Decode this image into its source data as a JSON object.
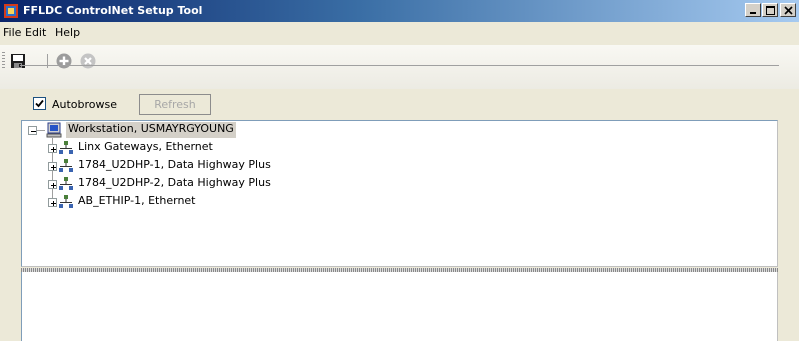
{
  "window": {
    "title": "FFLDC ControlNet Setup Tool",
    "icon": "app-icon",
    "buttons": [
      "minimize",
      "maximize",
      "close"
    ]
  },
  "menu": {
    "items": [
      "File",
      "Edit",
      "Help"
    ]
  },
  "toolbar": {
    "buttons": [
      "save-icon",
      "add-icon",
      "remove-icon"
    ]
  },
  "autobrowse": {
    "label": "Autobrowse",
    "checked": true
  },
  "refresh": {
    "label": "Refresh",
    "enabled": false
  },
  "tree": {
    "root": {
      "label": "Workstation, USMAYRGYOUNG",
      "expanded": true,
      "icon": "computer-icon",
      "selected": true
    },
    "children": [
      {
        "label": "Linx Gateways, Ethernet",
        "icon": "network-icon"
      },
      {
        "label": "1784_U2DHP-1, Data Highway Plus",
        "icon": "network-icon"
      },
      {
        "label": "1784_U2DHP-2, Data Highway Plus",
        "icon": "network-icon"
      },
      {
        "label": "AB_ETHIP-1, Ethernet",
        "icon": "network-icon"
      }
    ]
  },
  "colors": {
    "titlebar_start": "#0a246a",
    "titlebar_end": "#a6caf0",
    "selection": "#d4d0c8"
  }
}
